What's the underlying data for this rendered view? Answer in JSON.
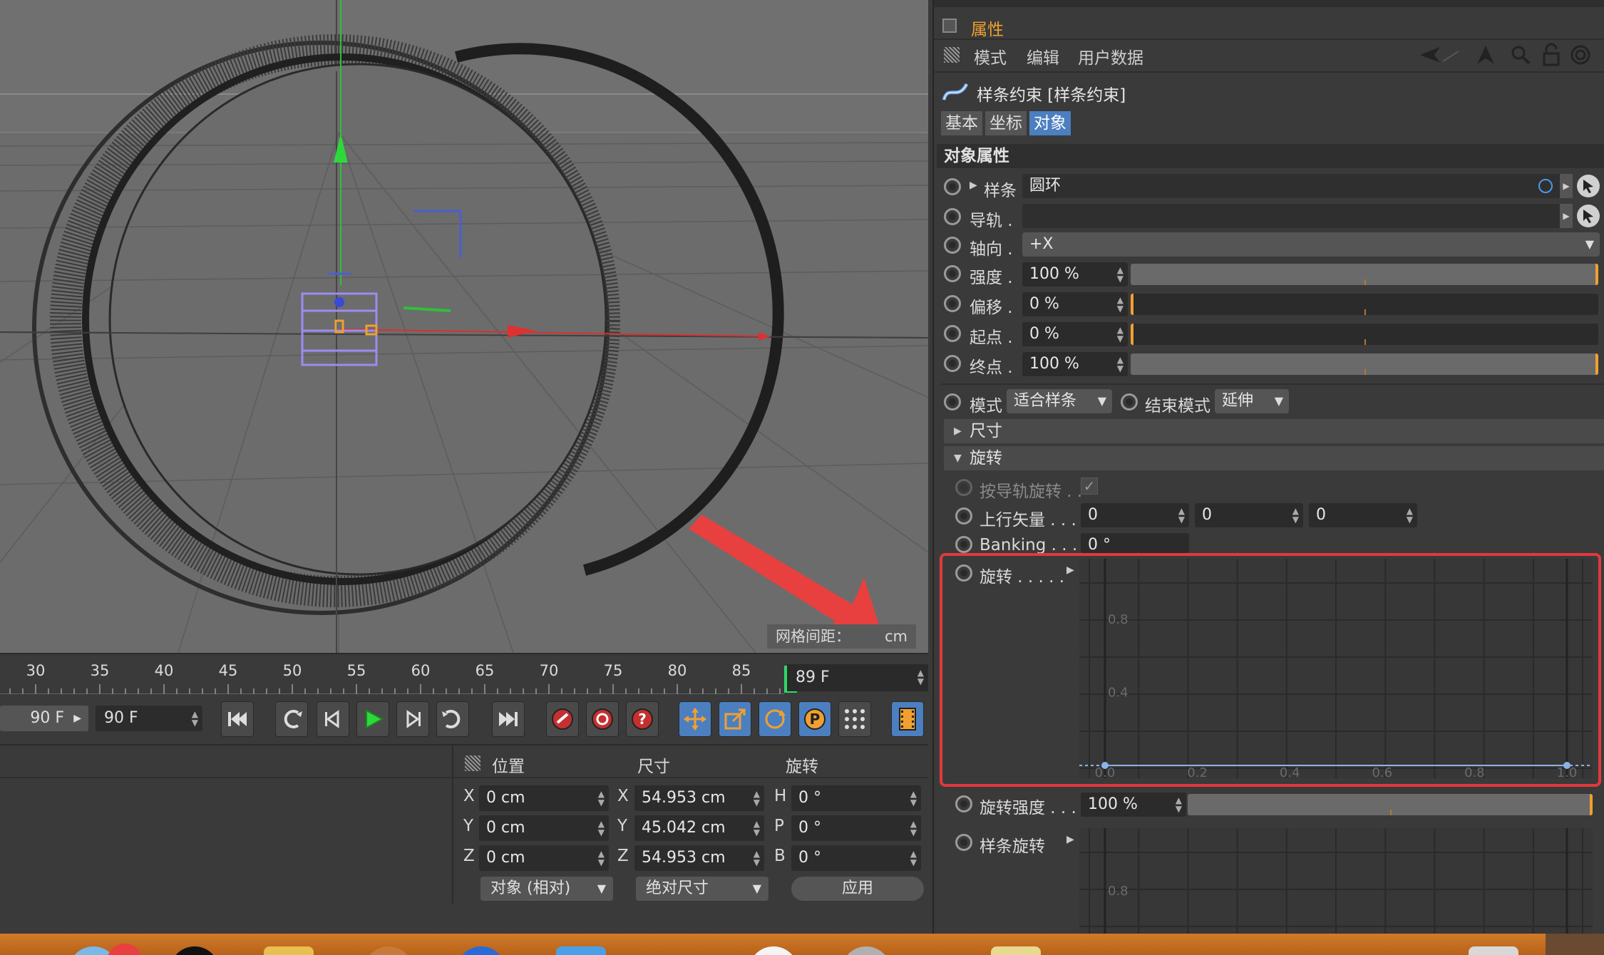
{
  "viewport": {
    "grid_spacing_label": "网格间距：",
    "grid_spacing_value": "cm"
  },
  "timeline": {
    "ticks": [
      "30",
      "35",
      "40",
      "45",
      "50",
      "55",
      "60",
      "65",
      "70",
      "75",
      "80",
      "85"
    ],
    "current_marker": "89",
    "current_frame": "89 F",
    "min_field": "90 F",
    "max_field": "90 F"
  },
  "transport": {
    "buttons": [
      "go-to-start",
      "previous-key",
      "previous-frame",
      "play",
      "next-frame",
      "next-key",
      "go-to-end",
      "record",
      "auto-key",
      "keyframe-selection",
      "move-tool",
      "scale-tool",
      "rotate-tool",
      "parameter-tool",
      "point-level",
      "timeline-window"
    ]
  },
  "coords": {
    "headers": {
      "position": "位置",
      "size": "尺寸",
      "rotation": "旋转"
    },
    "axes_pos": [
      "X",
      "Y",
      "Z"
    ],
    "axes_rot": [
      "H",
      "P",
      "B"
    ],
    "position": [
      "0 cm",
      "0 cm",
      "0 cm"
    ],
    "size": [
      "54.953 cm",
      "45.042 cm",
      "54.953 cm"
    ],
    "rotation": [
      "0 °",
      "0 °",
      "0 °"
    ],
    "mode_dropdown": "对象 (相对)",
    "size_dropdown": "绝对尺寸",
    "apply_button": "应用"
  },
  "attributes": {
    "title": "属性",
    "menu": [
      "模式",
      "编辑",
      "用户数据"
    ],
    "object_name": "样条约束 [样条约束]",
    "tabs": [
      "基本",
      "坐标",
      "对象"
    ],
    "active_tab": "对象",
    "section_title": "对象属性",
    "spline": {
      "label": "样条",
      "value": "圆环"
    },
    "rail": {
      "label": "导轨",
      "value": ""
    },
    "axis": {
      "label": "轴向",
      "value": "+X"
    },
    "strength": {
      "label": "强度",
      "value": "100 %",
      "level": 1.0
    },
    "offset": {
      "label": "偏移",
      "value": "0 %",
      "level": 0.0
    },
    "start": {
      "label": "起点",
      "value": "0 %",
      "level": 0.0
    },
    "end": {
      "label": "终点",
      "value": "100 %",
      "level": 1.0
    },
    "mode": {
      "label": "模式",
      "value": "适合样条"
    },
    "end_mode": {
      "label": "结束模式",
      "value": "延伸"
    },
    "size_group": "尺寸",
    "rotation_group": "旋转",
    "rail_rotation": {
      "label": "按导轨旋转 . .",
      "checked": true
    },
    "up_vector": {
      "label": "上行矢量 . . . .",
      "values": [
        "0",
        "0",
        "0"
      ]
    },
    "banking": {
      "label": "Banking . . . .",
      "value": "0 °"
    },
    "rotation_curve": {
      "label": "旋转 . . . . .",
      "y_ticks": [
        "0.8",
        "0.4"
      ],
      "x_ticks": [
        "0.0",
        "0.2",
        "0.4",
        "0.6",
        "0.8",
        "1.0"
      ]
    },
    "rotation_strength": {
      "label": "旋转强度 . . . .",
      "value": "100 %",
      "level": 1.0
    },
    "spline_rotation": {
      "label": "样条旋转",
      "y_ticks": [
        "0.8"
      ]
    }
  },
  "colors": {
    "accent": "#f0a030",
    "tab_active": "#4b7fc0",
    "highlight": "#e0393e",
    "arrow": "#e8403f"
  }
}
